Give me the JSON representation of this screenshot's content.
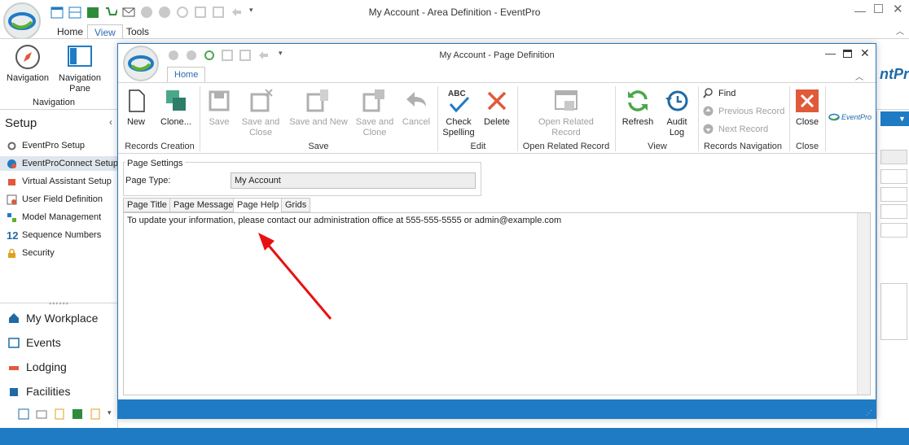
{
  "outer": {
    "title": "My Account - Area Definition - EventPro",
    "tabs": [
      "Home",
      "View",
      "Tools"
    ],
    "ribbon": {
      "navigation_label": "Navigation",
      "navigation_pane_label": "Navigation Pane",
      "group_label": "Navigation"
    },
    "brand_fragment": "ntPro"
  },
  "left_panel": {
    "setup_title": "Setup",
    "setup_items": [
      "EventPro Setup",
      "EventProConnect Setup",
      "Virtual Assistant Setup",
      "User Field Definition",
      "Model Management",
      "Sequence Numbers",
      "Security"
    ],
    "workspace_items": [
      "My Workplace",
      "Events",
      "Lodging",
      "Facilities"
    ],
    "sequence_prefix": "12"
  },
  "dialog": {
    "title": "My Account - Page Definition",
    "tab_home": "Home",
    "ribbon": {
      "new": "New",
      "clone": "Clone...",
      "save": "Save",
      "save_and_close": [
        "Save and",
        "Close"
      ],
      "save_and_new": "Save and New",
      "save_and_clone": [
        "Save and",
        "Clone"
      ],
      "cancel": "Cancel",
      "check_spelling": [
        "Check",
        "Spelling"
      ],
      "check_spelling_abc": "ABC",
      "delete": "Delete",
      "open_related_record": [
        "Open Related",
        "Record"
      ],
      "refresh": "Refresh",
      "audit_log": [
        "Audit",
        "Log"
      ],
      "find": "Find",
      "previous_record": "Previous Record",
      "next_record": "Next Record",
      "close": "Close",
      "brand": "EventPro",
      "groups": {
        "records_creation": "Records Creation",
        "save": "Save",
        "edit": "Edit",
        "open_related_record": "Open Related Record",
        "view": "View",
        "records_navigation": "Records Navigation",
        "close": "Close"
      }
    },
    "page_settings": {
      "legend": "Page Settings",
      "page_type_label": "Page Type:",
      "page_type_value": "My Account"
    },
    "page_tabs": [
      "Page Title",
      "Page Message",
      "Page Help",
      "Grids"
    ],
    "help_text": "To update your information, please contact our administration office at 555-555-5555 or admin@example.com"
  },
  "colors": {
    "accent": "#1f7bc4",
    "delete_red": "#e05a3a",
    "arrow_red": "#e81010"
  }
}
